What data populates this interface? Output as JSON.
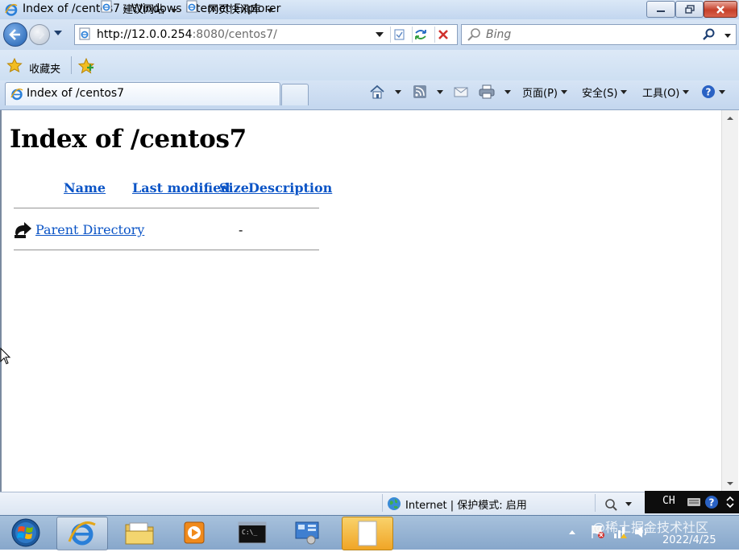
{
  "window": {
    "title": "Index of /centos7 - Windows Internet Explorer"
  },
  "address": {
    "url_host": "http://12.0.0.254",
    "url_rest": ":8080/centos7/"
  },
  "search": {
    "placeholder": "Bing"
  },
  "favorites": {
    "favorites_label": "收藏夹",
    "suggested_sites": "建议网站",
    "web_slice_gallery": "网页快讯库"
  },
  "tab": {
    "label": "Index of /centos7"
  },
  "commandbar": {
    "page": "页面(P)",
    "safety": "安全(S)",
    "tools": "工具(O)"
  },
  "page": {
    "heading": "Index of /centos7",
    "columns": {
      "name": "Name",
      "last_modified": "Last modified",
      "size": "Size",
      "description": "Description"
    },
    "rows": [
      {
        "name": "Parent Directory",
        "size": "-"
      }
    ]
  },
  "status": {
    "zone": "Internet | 保护模式: 启用"
  },
  "langbar": {
    "lang": "CH"
  },
  "taskbar": {
    "date": "2022/4/25",
    "watermark": "@稀土掘金技术社区"
  },
  "colors": {
    "link": "#0b54c6",
    "titlebar": "#c2d6ef",
    "taskbar": "#87a7cb"
  }
}
